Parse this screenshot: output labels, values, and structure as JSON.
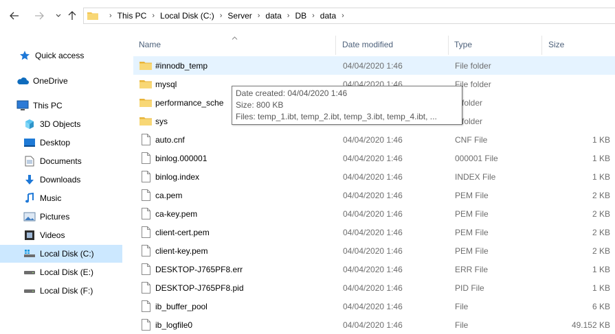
{
  "colors": {
    "folder": "#f3c552",
    "selected": "#cce8ff",
    "hover": "#e5f3ff",
    "header_text": "#4c607a",
    "detail_text": "#6d6d6d"
  },
  "breadcrumb": [
    "This PC",
    "Local Disk (C:)",
    "Server",
    "data",
    "DB",
    "data"
  ],
  "sidebar": [
    {
      "label": "Quick access",
      "icon": "star-icon"
    },
    {
      "label": "OneDrive",
      "icon": "cloud-icon"
    },
    {
      "label": "This PC",
      "icon": "monitor-icon"
    },
    {
      "label": "3D Objects",
      "icon": "cube-icon"
    },
    {
      "label": "Desktop",
      "icon": "desktop-icon"
    },
    {
      "label": "Documents",
      "icon": "document-icon"
    },
    {
      "label": "Downloads",
      "icon": "download-icon"
    },
    {
      "label": "Music",
      "icon": "music-note-icon"
    },
    {
      "label": "Pictures",
      "icon": "pictures-icon"
    },
    {
      "label": "Videos",
      "icon": "film-icon"
    },
    {
      "label": "Local Disk (C:)",
      "icon": "windows-drive-icon"
    },
    {
      "label": "Local Disk (E:)",
      "icon": "drive-icon"
    },
    {
      "label": "Local Disk (F:)",
      "icon": "drive-icon"
    }
  ],
  "columns": {
    "name": "Name",
    "date": "Date modified",
    "type": "Type",
    "size": "Size"
  },
  "files": [
    {
      "name": "#innodb_temp",
      "date": "04/04/2020 1:46",
      "type": "File folder",
      "size": "",
      "kind": "folder"
    },
    {
      "name": "mysql",
      "date": "04/04/2020 1:46",
      "type": "File folder",
      "size": "",
      "kind": "folder"
    },
    {
      "name": "performance_sche",
      "date": "",
      "type": "e folder",
      "size": "",
      "kind": "folder"
    },
    {
      "name": "sys",
      "date": "",
      "type": "e folder",
      "size": "",
      "kind": "folder"
    },
    {
      "name": "auto.cnf",
      "date": "04/04/2020 1:46",
      "type": "CNF File",
      "size": "1 KB",
      "kind": "file"
    },
    {
      "name": "binlog.000001",
      "date": "04/04/2020 1:46",
      "type": "000001 File",
      "size": "1 KB",
      "kind": "file"
    },
    {
      "name": "binlog.index",
      "date": "04/04/2020 1:46",
      "type": "INDEX File",
      "size": "1 KB",
      "kind": "file"
    },
    {
      "name": "ca.pem",
      "date": "04/04/2020 1:46",
      "type": "PEM File",
      "size": "2 KB",
      "kind": "file"
    },
    {
      "name": "ca-key.pem",
      "date": "04/04/2020 1:46",
      "type": "PEM File",
      "size": "2 KB",
      "kind": "file"
    },
    {
      "name": "client-cert.pem",
      "date": "04/04/2020 1:46",
      "type": "PEM File",
      "size": "2 KB",
      "kind": "file"
    },
    {
      "name": "client-key.pem",
      "date": "04/04/2020 1:46",
      "type": "PEM File",
      "size": "2 KB",
      "kind": "file"
    },
    {
      "name": "DESKTOP-J765PF8.err",
      "date": "04/04/2020 1:46",
      "type": "ERR File",
      "size": "1 KB",
      "kind": "file"
    },
    {
      "name": "DESKTOP-J765PF8.pid",
      "date": "04/04/2020 1:46",
      "type": "PID File",
      "size": "1 KB",
      "kind": "file"
    },
    {
      "name": "ib_buffer_pool",
      "date": "04/04/2020 1:46",
      "type": "File",
      "size": "6 KB",
      "kind": "file"
    },
    {
      "name": "ib_logfile0",
      "date": "04/04/2020 1:46",
      "type": "File",
      "size": "49.152 KB",
      "kind": "file"
    }
  ],
  "tooltip": {
    "created": "Date created: 04/04/2020 1:46",
    "size": "Size: 800 KB",
    "files": "Files: temp_1.ibt, temp_2.ibt, temp_3.ibt, temp_4.ibt, ..."
  }
}
